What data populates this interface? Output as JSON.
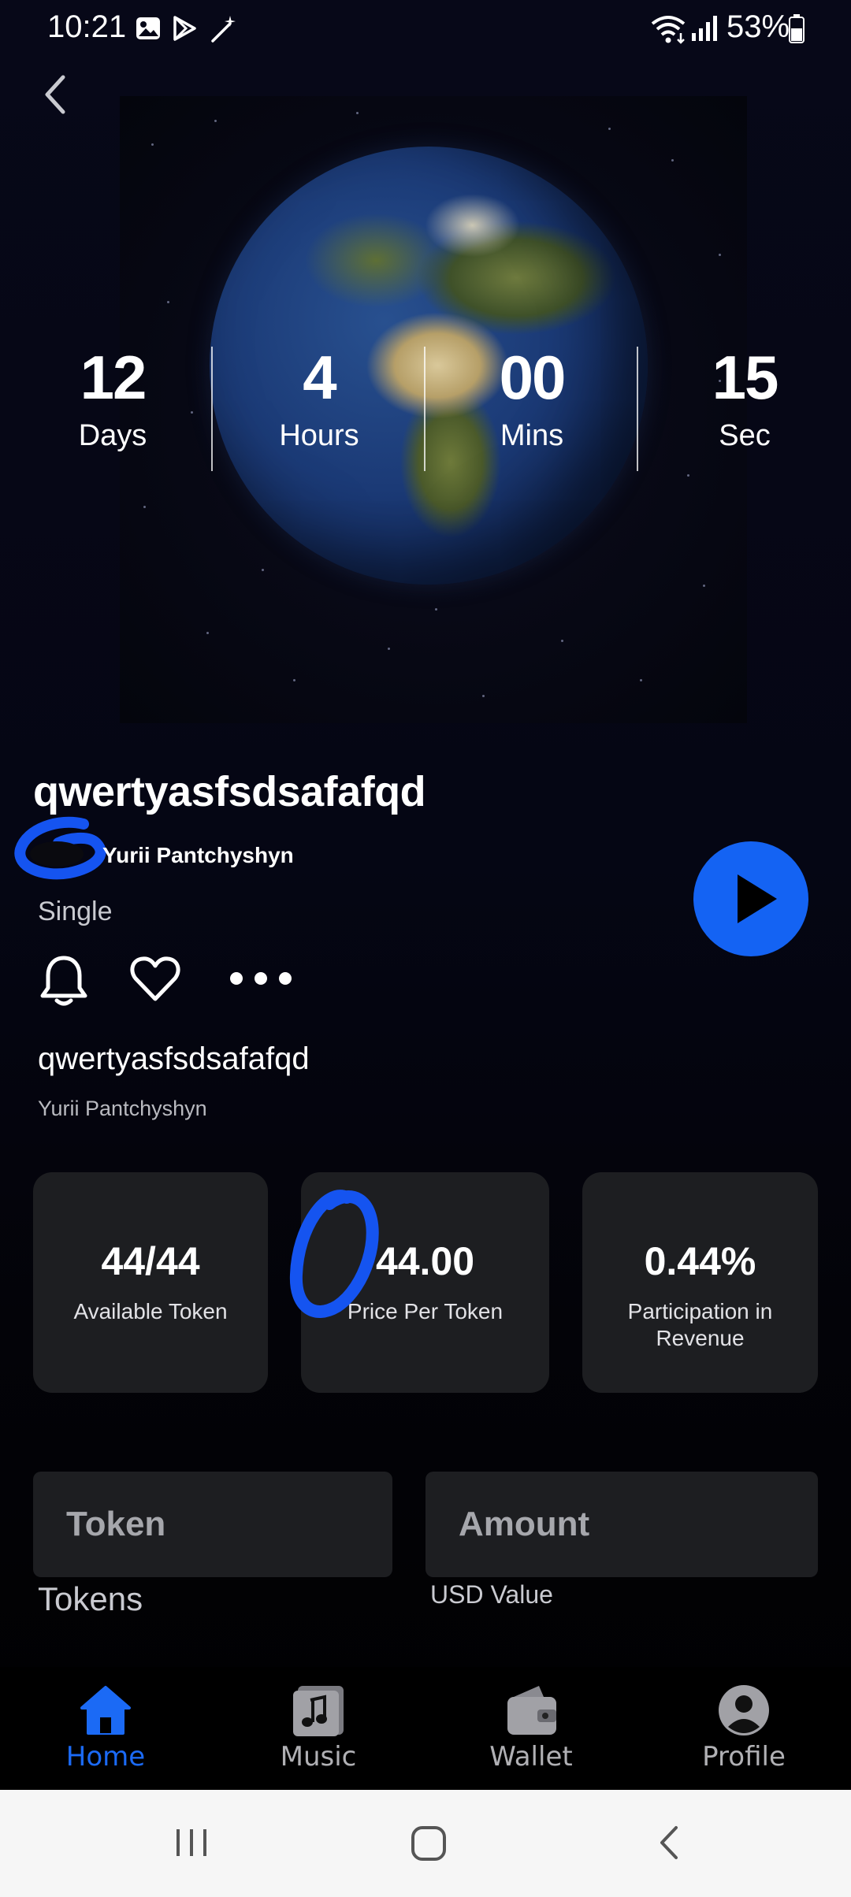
{
  "status_bar": {
    "time": "10:21",
    "battery": "53%",
    "icons": [
      "gallery-icon",
      "play-store-icon",
      "magic-wand-icon",
      "wifi-icon",
      "signal-icon",
      "battery-icon"
    ]
  },
  "countdown": {
    "days": {
      "value": "12",
      "label": "Days"
    },
    "hours": {
      "value": "4",
      "label": "Hours"
    },
    "mins": {
      "value": "00",
      "label": "Mins"
    },
    "secs": {
      "value": "15",
      "label": "Sec"
    }
  },
  "song": {
    "title": "qwertyasfsdsafafqd",
    "artist": "Yurii Pantchyshyn",
    "type": "Single"
  },
  "track": {
    "title": "qwertyasfsdsafafqd",
    "artist": "Yurii Pantchyshyn"
  },
  "stats": [
    {
      "value": "44/44",
      "label": "Available Token"
    },
    {
      "value": "44.00",
      "label": "Price Per Token"
    },
    {
      "value": "0.44%",
      "label": "Participation in Revenue"
    }
  ],
  "inputs": {
    "token_placeholder": "Token",
    "amount_placeholder": "Amount",
    "token_caption": "Tokens",
    "usd_caption": "USD Value"
  },
  "nav": [
    {
      "label": "Home",
      "icon": "home-icon",
      "active": true
    },
    {
      "label": "Music",
      "icon": "music-icon",
      "active": false
    },
    {
      "label": "Wallet",
      "icon": "wallet-icon",
      "active": false
    },
    {
      "label": "Profile",
      "icon": "profile-icon",
      "active": false
    }
  ],
  "colors": {
    "accent": "#1463f3",
    "background": "#050614",
    "card": "#1d1e21",
    "nav_active": "#1b6af5"
  }
}
